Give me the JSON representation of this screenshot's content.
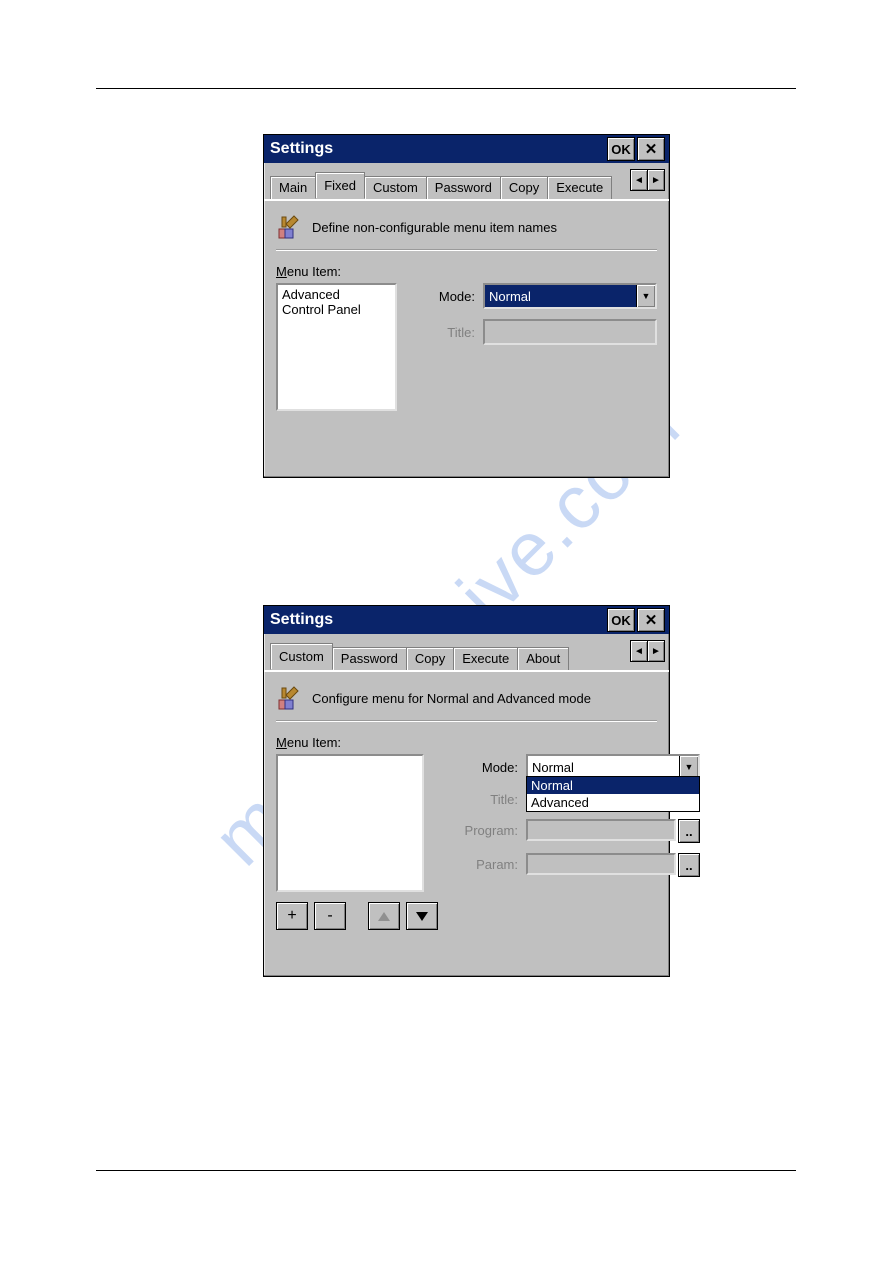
{
  "watermark": "manualshive.com",
  "dialog1": {
    "title": "Settings",
    "ok_label": "OK",
    "tabs": [
      "Main",
      "Fixed",
      "Custom",
      "Password",
      "Copy",
      "Execute"
    ],
    "active_tab": "Fixed",
    "description": "Define non-configurable menu item names",
    "menu_item_label": "Menu Item:",
    "menu_items": [
      "Advanced",
      "Control Panel"
    ],
    "mode_label": "Mode:",
    "mode_value": "Normal",
    "title_label": "Title:"
  },
  "dialog2": {
    "title": "Settings",
    "ok_label": "OK",
    "tabs": [
      "Custom",
      "Password",
      "Copy",
      "Execute",
      "About"
    ],
    "active_tab": "Custom",
    "description": "Configure menu for Normal and Advanced mode",
    "menu_item_label": "Menu Item:",
    "mode_label": "Mode:",
    "mode_value": "Normal",
    "mode_options": [
      "Normal",
      "Advanced"
    ],
    "title_label": "Title:",
    "program_label": "Program:",
    "param_label": "Param:",
    "add_label": "+",
    "remove_label": "-"
  }
}
